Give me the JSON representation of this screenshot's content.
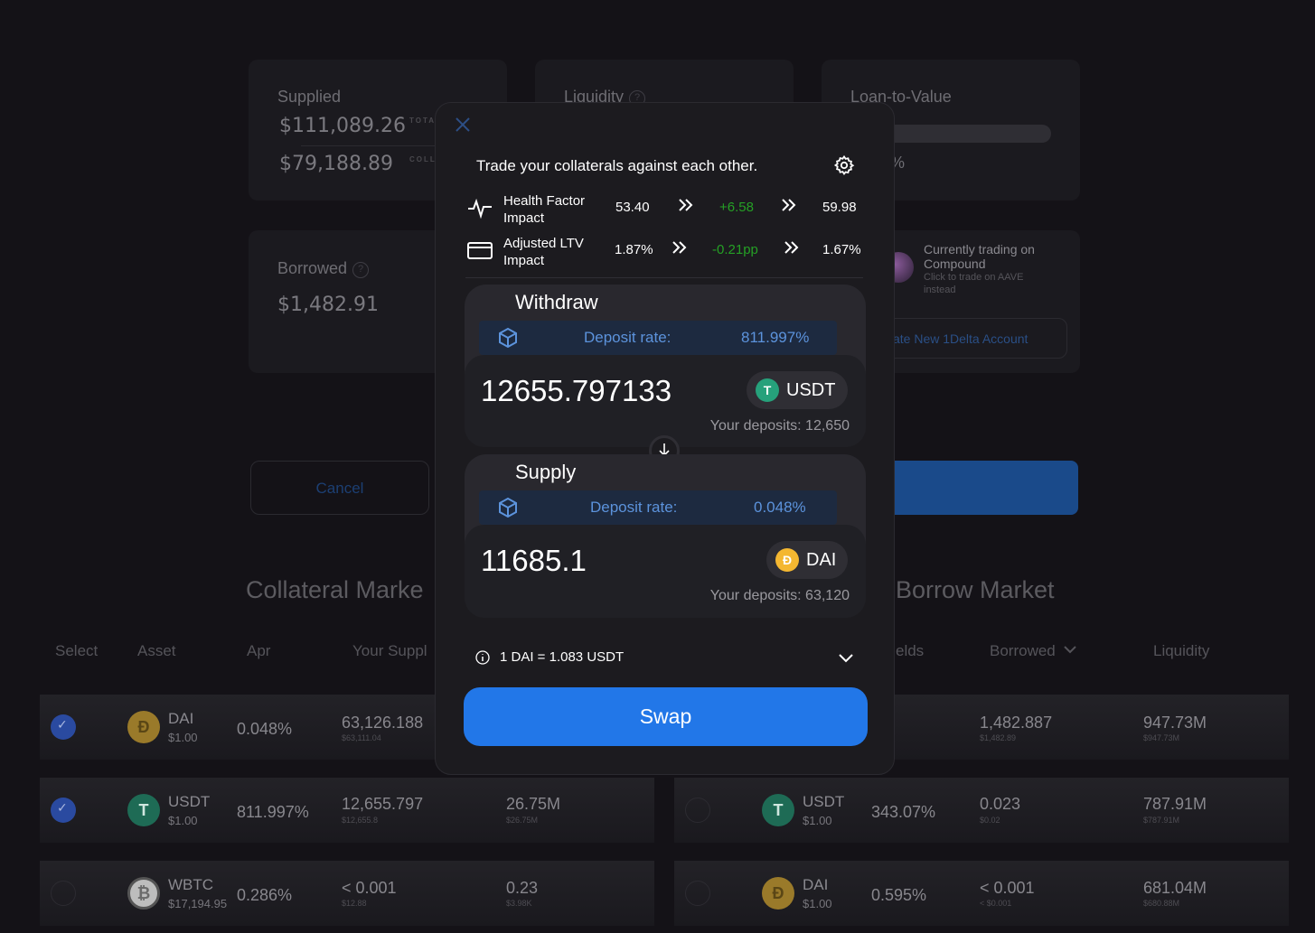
{
  "summary": {
    "supplied_label": "Supplied",
    "supplied_total": "$111,089.26",
    "supplied_total_tag": "TOTA",
    "supplied_collateral": "$79,188.89",
    "supplied_collateral_tag": "COLL",
    "liquidity_label": "Liquidity",
    "ltv_label": "Loan-to-Value",
    "ltv_fragment": "%",
    "borrowed_label": "Borrowed",
    "borrowed_value": "$1,482.91"
  },
  "trading": {
    "line1": "Currently trading on",
    "line2": "Compound",
    "hint1": "Click to trade on AAVE",
    "hint2": "instead",
    "create_account": "ate New 1Delta Account"
  },
  "actions": {
    "cancel": "Cancel"
  },
  "markets": {
    "collateral_title": "Collateral Marke",
    "borrow_title": "Borrow Market",
    "headers": {
      "select": "Select",
      "asset": "Asset",
      "apr": "Apr",
      "your_supply": "Your Suppl",
      "yields": "elds",
      "borrowed": "Borrowed",
      "liquidity": "Liquidity"
    },
    "collateral_rows": [
      {
        "name": "DAI",
        "price": "$1.00",
        "apr": "0.048%",
        "supply": "63,126.188",
        "supply_usd": "$63,111.04",
        "liq": "",
        "liq_usd": ""
      },
      {
        "name": "USDT",
        "price": "$1.00",
        "apr": "811.997%",
        "supply": "12,655.797",
        "supply_usd": "$12,655.8",
        "liq": "26.75M",
        "liq_usd": "$26.75M"
      },
      {
        "name": "WBTC",
        "price": "$17,194.95",
        "apr": "0.286%",
        "supply": "< 0.001",
        "supply_usd": "$12.88",
        "liq": "0.23",
        "liq_usd": "$3.98K"
      }
    ],
    "borrow_rows": [
      {
        "name": "",
        "price": "",
        "apr": "",
        "borrowed": "1,482.887",
        "borrowed_usd": "$1,482.89",
        "liq": "947.73M",
        "liq_usd": "$947.73M"
      },
      {
        "name": "USDT",
        "price": "$1.00",
        "apr": "343.07%",
        "borrowed": "0.023",
        "borrowed_usd": "$0.02",
        "liq": "787.91M",
        "liq_usd": "$787.91M"
      },
      {
        "name": "DAI",
        "price": "$1.00",
        "apr": "0.595%",
        "borrowed": "< 0.001",
        "borrowed_usd": "< $0.001",
        "liq": "681.04M",
        "liq_usd": "$680.88M"
      }
    ]
  },
  "modal": {
    "title": "Trade your collaterals against each other.",
    "health": {
      "label1": "Health Factor",
      "label2": "Impact",
      "before": "53.40",
      "delta": "+6.58",
      "after": "59.98"
    },
    "ltv": {
      "label1": "Adjusted LTV",
      "label2": "Impact",
      "before": "1.87%",
      "delta": "-0.21pp",
      "after": "1.67%"
    },
    "withdraw": {
      "heading": "Withdraw",
      "rate_label": "Deposit rate:",
      "rate_value": "811.997%",
      "amount": "12655.797133",
      "token": "USDT",
      "deposits": "Your deposits: 12,650"
    },
    "supply": {
      "heading": "Supply",
      "rate_label": "Deposit rate:",
      "rate_value": "0.048%",
      "amount": "11685.1",
      "token": "DAI",
      "deposits": "Your deposits: 63,120"
    },
    "exchange_rate": "1 DAI = 1.083 USDT",
    "swap_label": "Swap"
  },
  "colors": {
    "accent": "#2277e8",
    "positive": "#25a025",
    "rate_text": "#5c93dc"
  }
}
